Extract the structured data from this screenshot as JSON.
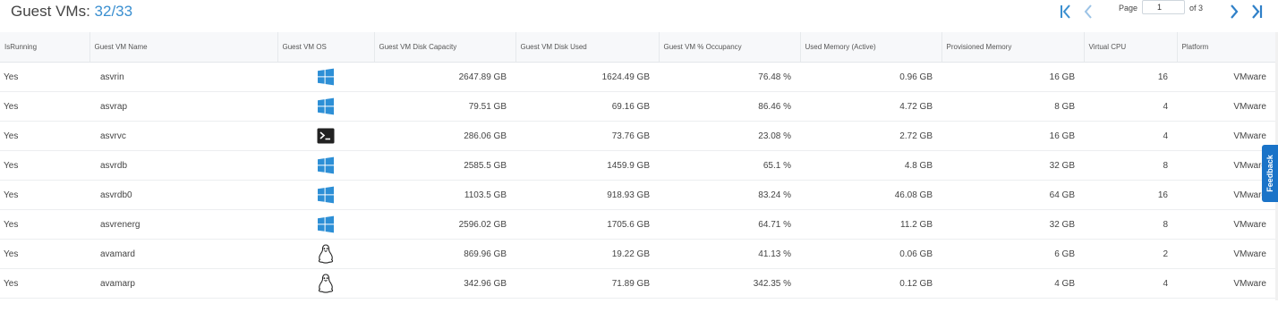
{
  "header": {
    "title_label": "Guest VMs:",
    "title_count": "32/33"
  },
  "pagination": {
    "page_label": "Page",
    "current_page": "1",
    "of_label": "of 3",
    "first_icon": "first-page-icon",
    "prev_icon": "prev-page-icon",
    "next_icon": "next-page-icon",
    "last_icon": "last-page-icon"
  },
  "colors": {
    "accent": "#3a8fd0",
    "windows": "#2d8fd6",
    "feedback": "#1a73c8"
  },
  "table": {
    "columns": [
      "IsRunning",
      "Guest VM Name",
      "Guest VM OS",
      "Guest VM Disk Capacity",
      "Guest VM Disk Used",
      "Guest VM % Occupancy",
      "Used Memory (Active)",
      "Provisioned Memory",
      "Virtual CPU",
      "Platform"
    ],
    "rows": [
      {
        "running": "Yes",
        "name": "asvrin",
        "os": "windows",
        "capacity": "2647.89 GB",
        "used": "1624.49 GB",
        "occupancy": "76.48 %",
        "mem_active": "0.96 GB",
        "mem_prov": "16 GB",
        "vcpu": "16",
        "platform": "VMware"
      },
      {
        "running": "Yes",
        "name": "asvrap",
        "os": "windows",
        "capacity": "79.51 GB",
        "used": "69.16 GB",
        "occupancy": "86.46 %",
        "mem_active": "4.72 GB",
        "mem_prov": "8 GB",
        "vcpu": "4",
        "platform": "VMware"
      },
      {
        "running": "Yes",
        "name": "asvrvc",
        "os": "terminal",
        "capacity": "286.06 GB",
        "used": "73.76 GB",
        "occupancy": "23.08 %",
        "mem_active": "2.72 GB",
        "mem_prov": "16 GB",
        "vcpu": "4",
        "platform": "VMware"
      },
      {
        "running": "Yes",
        "name": "asvrdb",
        "os": "windows",
        "capacity": "2585.5 GB",
        "used": "1459.9 GB",
        "occupancy": "65.1 %",
        "mem_active": "4.8 GB",
        "mem_prov": "32 GB",
        "vcpu": "8",
        "platform": "VMware"
      },
      {
        "running": "Yes",
        "name": "asvrdb0",
        "os": "windows",
        "capacity": "1103.5 GB",
        "used": "918.93 GB",
        "occupancy": "83.24 %",
        "mem_active": "46.08 GB",
        "mem_prov": "64 GB",
        "vcpu": "16",
        "platform": "VMware"
      },
      {
        "running": "Yes",
        "name": "asvrenerg",
        "os": "windows",
        "capacity": "2596.02 GB",
        "used": "1705.6 GB",
        "occupancy": "64.71 %",
        "mem_active": "11.2 GB",
        "mem_prov": "32 GB",
        "vcpu": "8",
        "platform": "VMware"
      },
      {
        "running": "Yes",
        "name": "avamard",
        "os": "linux",
        "capacity": "869.96 GB",
        "used": "19.22 GB",
        "occupancy": "41.13 %",
        "mem_active": "0.06 GB",
        "mem_prov": "6 GB",
        "vcpu": "2",
        "platform": "VMware"
      },
      {
        "running": "Yes",
        "name": "avamarp",
        "os": "linux",
        "capacity": "342.96 GB",
        "used": "71.89 GB",
        "occupancy": "342.35 %",
        "mem_active": "0.12 GB",
        "mem_prov": "4 GB",
        "vcpu": "4",
        "platform": "VMware"
      }
    ]
  },
  "feedback": {
    "label": "Feedback"
  }
}
